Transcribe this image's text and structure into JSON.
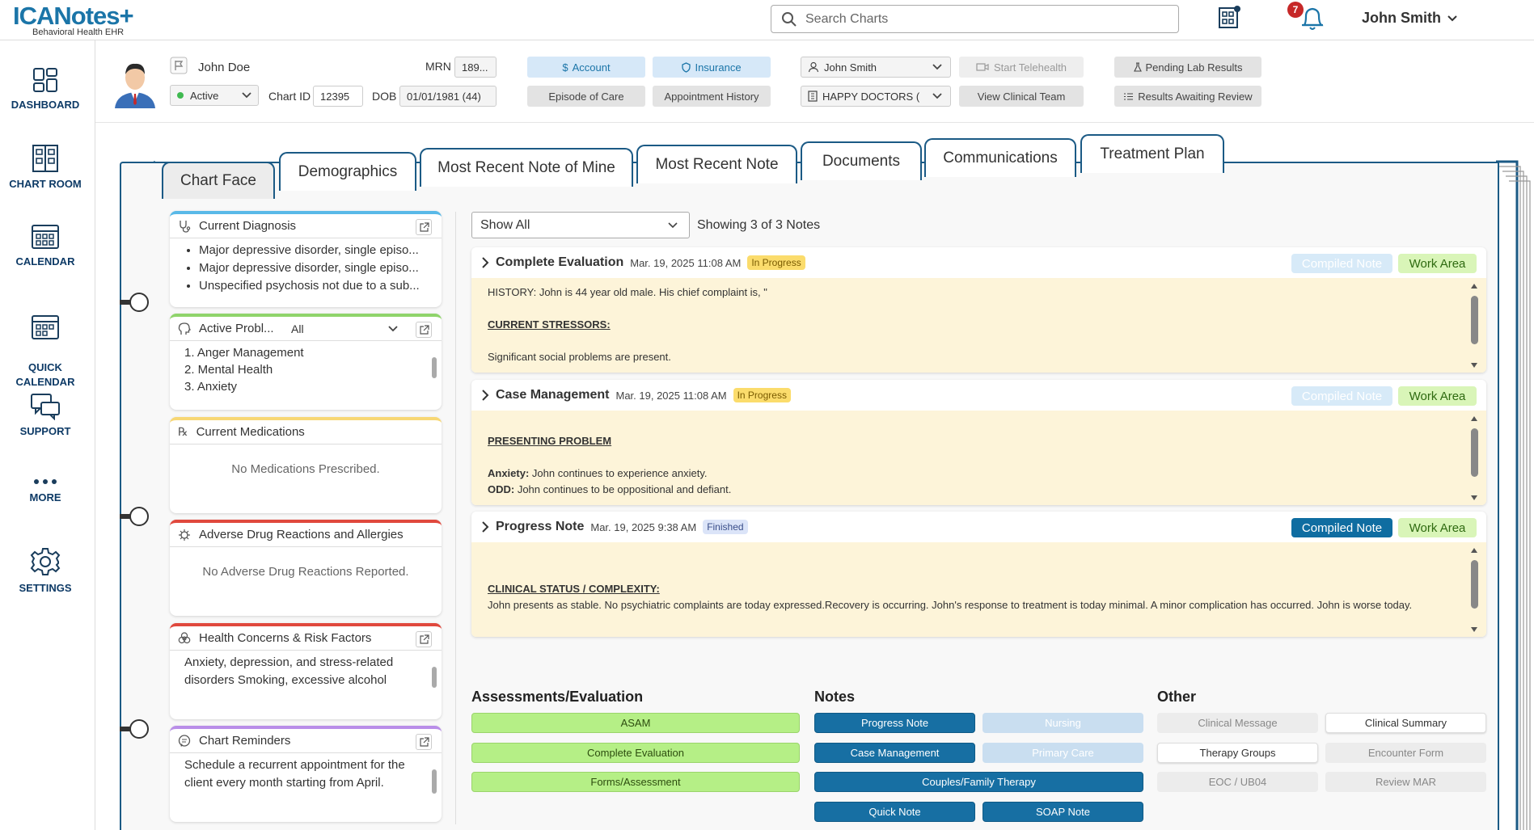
{
  "app": {
    "logo": "ICANotes",
    "logo_sub": "Behavioral Health EHR",
    "search_placeholder": "Search Charts",
    "notifications_count": "7",
    "user_name": "John Smith"
  },
  "sidebar": {
    "items": [
      {
        "label": "DASHBOARD",
        "icon": "dashboard-icon"
      },
      {
        "label": "CHART ROOM",
        "icon": "chart-room-icon"
      },
      {
        "label": "CALENDAR",
        "icon": "calendar-icon"
      },
      {
        "label": "QUICK\nCALENDAR",
        "icon": "quick-calendar-icon"
      },
      {
        "label": "SUPPORT",
        "icon": "support-icon"
      },
      {
        "label": "MORE",
        "icon": "more-icon"
      },
      {
        "label": "SETTINGS",
        "icon": "settings-icon"
      }
    ]
  },
  "patient": {
    "name": "John Doe",
    "status": "Active",
    "mrn_label": "MRN",
    "mrn": "189...",
    "chart_id_label": "Chart ID",
    "chart_id": "12395",
    "dob_label": "DOB",
    "dob": "01/01/1981 (44)",
    "buttons": {
      "account": "Account",
      "insurance": "Insurance",
      "episode": "Episode of Care",
      "appt_history": "Appointment History",
      "provider": "John Smith",
      "practice": "HAPPY DOCTORS (",
      "telehealth": "Start Telehealth",
      "clinical_team": "View Clinical Team",
      "pending_lab": "Pending Lab Results",
      "results_review": "Results Awaiting Review"
    }
  },
  "tabs": [
    "Chart Face",
    "Demographics",
    "Most Recent Note of Mine",
    "Most Recent Note",
    "Documents",
    "Communications",
    "Treatment Plan"
  ],
  "panels": {
    "diagnosis": {
      "title": "Current Diagnosis",
      "items": [
        "Major depressive disorder, single episo...",
        "Major depressive disorder, single episo...",
        "Unspecified psychosis not due to a sub..."
      ]
    },
    "problems": {
      "title": "Active Probl...",
      "filter": "All",
      "items": [
        "1. Anger Management",
        "2. Mental Health",
        "3. Anxiety"
      ]
    },
    "medications": {
      "title": "Current Medications",
      "empty": "No Medications Prescribed."
    },
    "adverse": {
      "title": "Adverse Drug Reactions and Allergies",
      "empty": "No Adverse Drug Reactions Reported."
    },
    "health": {
      "title": "Health Concerns & Risk Factors",
      "text": "Anxiety, depression, and stress-related disorders Smoking, excessive alcohol"
    },
    "reminders": {
      "title": "Chart Reminders",
      "text": "Schedule a recurrent appointment for the client every month starting from April."
    }
  },
  "notes_area": {
    "filter": "Show All",
    "showing": "Showing 3 of 3 Notes",
    "compiled_label": "Compiled Note",
    "work_label": "Work Area",
    "notes": [
      {
        "title": "Complete Evaluation",
        "date": "Mar. 19, 2025 11:08 AM",
        "status": "In Progress",
        "line1": "HISTORY: John is 44 year old male. His chief complaint is, \"",
        "heading": "CURRENT STRESSORS:",
        "line2": "Significant social problems are present."
      },
      {
        "title": "Case Management",
        "date": "Mar. 19, 2025 11:08 AM",
        "status": "In Progress",
        "heading": "PRESENTING PROBLEM",
        "l1_label": "Anxiety:",
        "l1_text": " John continues to experience anxiety.",
        "l2_label": "ODD:",
        "l2_text": " John continues to be oppositional and defiant."
      },
      {
        "title": "Progress Note",
        "date": "Mar. 19, 2025 9:38 AM",
        "status": "Finished",
        "heading": "CLINICAL STATUS / COMPLEXITY:",
        "line1": "John presents as stable. No psychiatric complaints are today expressed.Recovery is occurring. John's response to treatment is today minimal. A minor complication has occurred. John is worse today."
      }
    ]
  },
  "note_types": {
    "assess_title": "Assessments/Evaluation",
    "notes_title": "Notes",
    "other_title": "Other",
    "assess": [
      "ASAM",
      "Complete Evaluation",
      "Forms/Assessment"
    ],
    "notes": [
      "Progress Note",
      "Nursing",
      "Case Management",
      "Primary Care",
      "Couples/Family Therapy",
      "Quick Note",
      "SOAP Note"
    ],
    "other": [
      "Clinical Message",
      "Clinical Summary",
      "Therapy Groups",
      "Encounter Form",
      "EOC / UB04",
      "Review MAR"
    ]
  },
  "colors": {
    "brand": "#1b75a8",
    "navy": "#0d3a66",
    "note_bg": "#fdf4d9",
    "green_btn": "#b5ef86",
    "blue_btn": "#176fa3"
  }
}
